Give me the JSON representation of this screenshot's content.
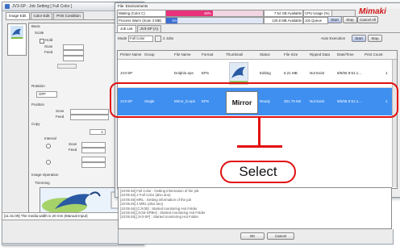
{
  "back_window": {
    "title": "JV3-SP : Job Setting [ Full Color ]",
    "tabs": [
      "Image Edit",
      "Color Edit",
      "Print Condition"
    ],
    "basic_label": "Basic",
    "scale_label": "Scale",
    "hold_label": "Hold",
    "scan_label": "Scan",
    "feed_label": "Feed",
    "rotation_label": "Rotation",
    "rotation_value": "OFF",
    "position_label": "Position",
    "copy_label": "Copy",
    "copy_value": "1",
    "interval_label": "Interval",
    "image_operation_label": "Image Operation",
    "trimming_label": "Trimming",
    "status_text": "[11:31:09] The media width is 20 mm (Manual Input)",
    "ok_label": "OK",
    "cancel_label": "Cancel"
  },
  "front_window": {
    "menu": [
      "File",
      "Environments"
    ],
    "status_rows": [
      {
        "label": "Waiting (Color C)",
        "bar_text": "48%",
        "bar_color": "#e8327a",
        "info": "7.54 GB Available",
        "extra": "CPU Usage (%)"
      },
      {
        "label": "Process  Warm  (Scan 3 MB)",
        "bar_text": "1%",
        "bar_color": "#3b6fd6",
        "info": "125.8 MB Available",
        "extra": "Job Queue"
      }
    ],
    "logo_text": "Mimaki",
    "start_label": "Start",
    "stop_label": "Stop",
    "cancel_all_label": "Cancel All",
    "job_tabs": [
      "Job List",
      "JV3-SP (A)"
    ],
    "mode_label": "Mode",
    "mode_value": "Full Color",
    "job_count": "2 Jobs",
    "auto_execution_label": "Auto Execution",
    "columns": [
      "Printer Name",
      "Group",
      "File Name",
      "Format",
      "Thumbnail",
      "Status",
      "File Size",
      "Ripped Data",
      "Date/Time",
      "Print Count"
    ],
    "rows": [
      {
        "printer": "JV3-SP",
        "group": "",
        "file": "Dolphin.eps",
        "format": "EPS",
        "thumb": "dolphin-thumbnail",
        "status": "Editing",
        "size": "6.21 MB",
        "ripped": "Not Exist",
        "date": "9/5/06 8:51:1...",
        "count": "1",
        "selected": false
      },
      {
        "printer": "JV3-SP",
        "group": "Single",
        "file": "Mirror_D.eps",
        "format": "EPS",
        "thumb": "Mirror",
        "status": "Ready",
        "size": "301.79 KB",
        "ripped": "Not Exist",
        "date": "9/5/06 8:51:1...",
        "count": "1",
        "selected": true
      }
    ],
    "log_lines": [
      "[10:05:46] Full Color : Getting information of the job",
      "[10:05:46] 2 Full Color (also ano)",
      "[10:05:46] MRL : Getting information of the job",
      "[10:05:46] 4 MRL (also ano)",
      "[10:05:46] [CJV30] : Started monitoring Hot Folder",
      "[10:05:46] [JV33-SPBH] : Started monitoring Hot Folder",
      "[10:05:46] [JV3-SP] : Started monitoring Hot Folder"
    ]
  },
  "callout": {
    "label": "Select",
    "color": "#e21010"
  }
}
